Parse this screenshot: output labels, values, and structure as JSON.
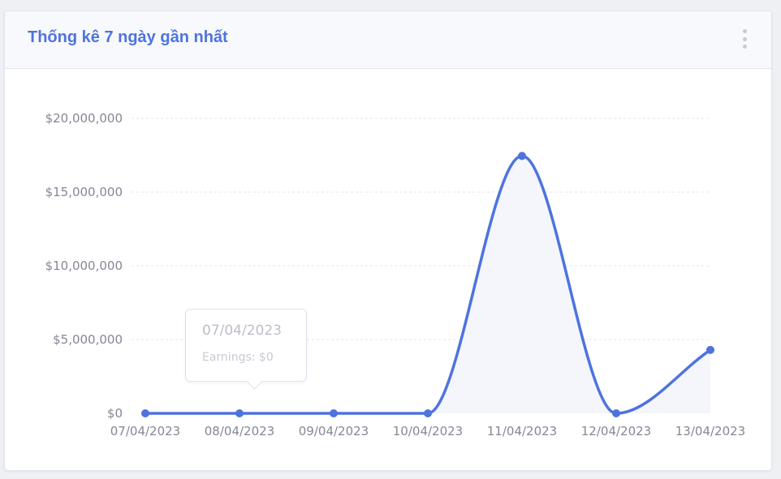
{
  "card": {
    "title": "Thống kê 7 ngày gần nhất",
    "menu_icon": "vertical-ellipsis-icon"
  },
  "colors": {
    "accent": "#4e73df",
    "area_fill": "#f4f6fc",
    "grid": "#e3e6f0",
    "tick_text": "#858796"
  },
  "tooltip": {
    "title": "07/04/2023",
    "body": "Earnings: $0"
  },
  "chart_data": {
    "type": "area",
    "categories": [
      "07/04/2023",
      "08/04/2023",
      "09/04/2023",
      "10/04/2023",
      "11/04/2023",
      "12/04/2023",
      "13/04/2023"
    ],
    "series": [
      {
        "values": [
          0,
          0,
          0,
          0,
          17450000,
          0,
          4300000
        ]
      }
    ],
    "y_ticks": [
      0,
      5000000,
      10000000,
      15000000,
      20000000
    ],
    "y_tick_labels": [
      "$0",
      "$5,000,000",
      "$10,000,000",
      "$15,000,000",
      "$20,000,000"
    ],
    "ylim": [
      0,
      20000000
    ],
    "grid": true,
    "grid_style": "dashed horizontal",
    "legend": false,
    "title": "",
    "xlabel": "",
    "ylabel": ""
  }
}
